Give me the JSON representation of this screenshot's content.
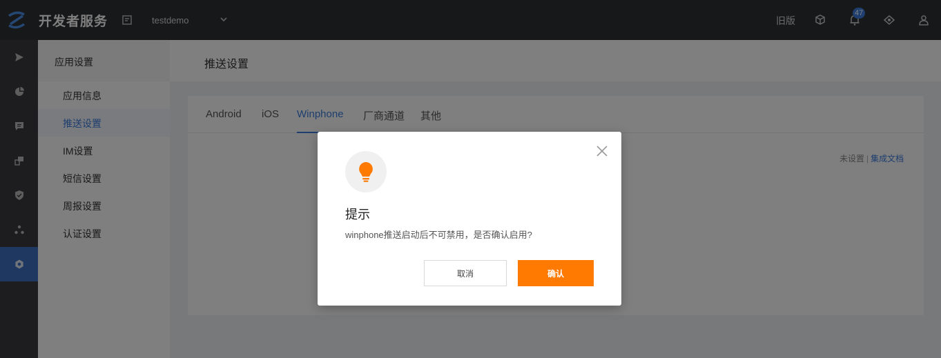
{
  "topbar": {
    "brand": "开发者服务",
    "app_name": "testdemo",
    "old_version": "旧版",
    "notification_count": "47",
    "icons": [
      "logo-icon",
      "document-icon",
      "chevron-down-icon",
      "cube-icon",
      "bell-icon",
      "gem-icon",
      "user-icon"
    ]
  },
  "rail": {
    "items": [
      "send-icon",
      "pie-chart-icon",
      "message-icon",
      "devices-icon",
      "shield-icon",
      "share-nodes-icon",
      "settings-icon"
    ],
    "active_index": 6
  },
  "subnav": {
    "header": "应用设置",
    "items": [
      {
        "label": "应用信息"
      },
      {
        "label": "推送设置",
        "active": true
      },
      {
        "label": "IM设置"
      },
      {
        "label": "短信设置"
      },
      {
        "label": "周报设置"
      },
      {
        "label": "认证设置"
      }
    ]
  },
  "page": {
    "title": "推送设置",
    "tabs": [
      {
        "label": "Android"
      },
      {
        "label": "iOS"
      },
      {
        "label": "Winphone",
        "active": true
      },
      {
        "label": "厂商通道"
      },
      {
        "label": "其他"
      }
    ],
    "status_text": "未设置",
    "status_separator": "|",
    "doc_link": "集成文档"
  },
  "modal": {
    "icon": "lightbulb-icon",
    "title": "提示",
    "message": "winphone推送启动后不可禁用，是否确认启用?",
    "cancel_label": "取消",
    "confirm_label": "确认"
  },
  "colors": {
    "topbar_bg": "#2f3033",
    "accent": "#3b7ddd",
    "primary_button": "#ff7a00",
    "lightbulb": "#ff7a00"
  }
}
